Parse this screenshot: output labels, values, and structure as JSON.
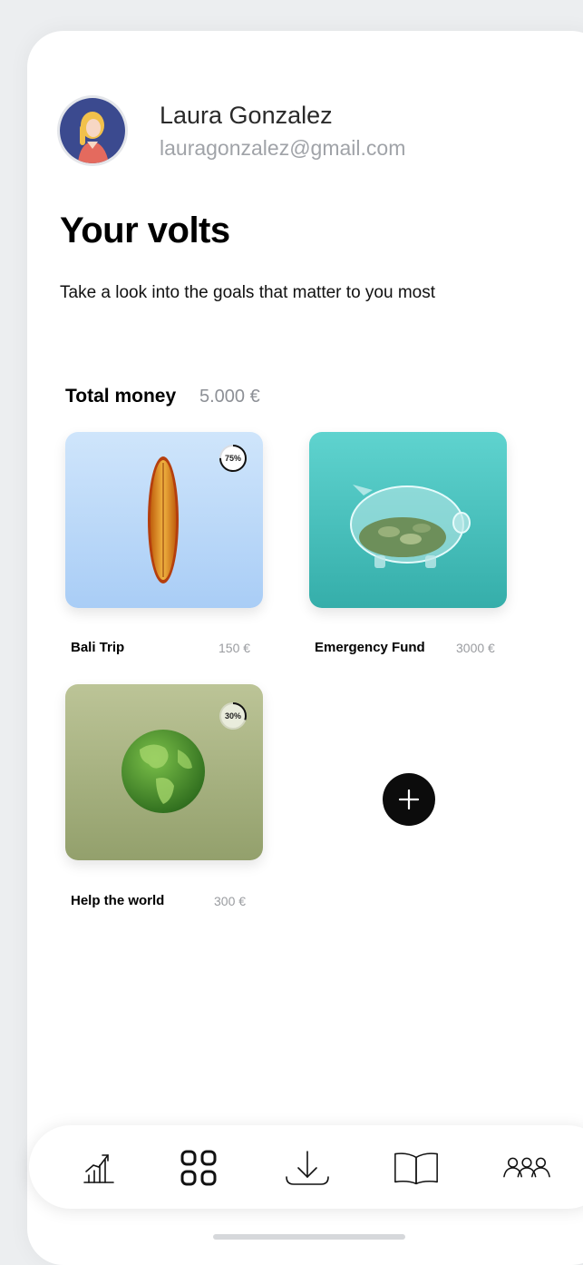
{
  "user": {
    "name": "Laura Gonzalez",
    "email": "lauragonzalez@gmail.com"
  },
  "page": {
    "title": "Your volts",
    "subtitle": "Take a look into the goals that matter to you most"
  },
  "summary": {
    "total_label": "Total money",
    "total_value": "5.000 €"
  },
  "goals": [
    {
      "name": "Bali Trip",
      "amount": "150 €",
      "progress_label": "75%",
      "progress": 0.75,
      "image": "surfboard"
    },
    {
      "name": "Emergency Fund",
      "amount": "3000 €",
      "image": "piggy-bank"
    },
    {
      "name": "Help the world",
      "amount": "300 €",
      "progress_label": "30%",
      "progress": 0.3,
      "image": "green-globe"
    }
  ],
  "add_goal_icon": "plus-icon",
  "bottom_nav": [
    {
      "icon": "chart-icon"
    },
    {
      "icon": "grid-icon"
    },
    {
      "icon": "download-icon"
    },
    {
      "icon": "book-icon"
    },
    {
      "icon": "people-icon"
    }
  ],
  "colors": {
    "accent": "#000000",
    "secondary_text": "#a0a3a8",
    "card_blue": "#bcd9f8",
    "card_teal": "#47c1bd",
    "card_olive": "#a7b184"
  }
}
